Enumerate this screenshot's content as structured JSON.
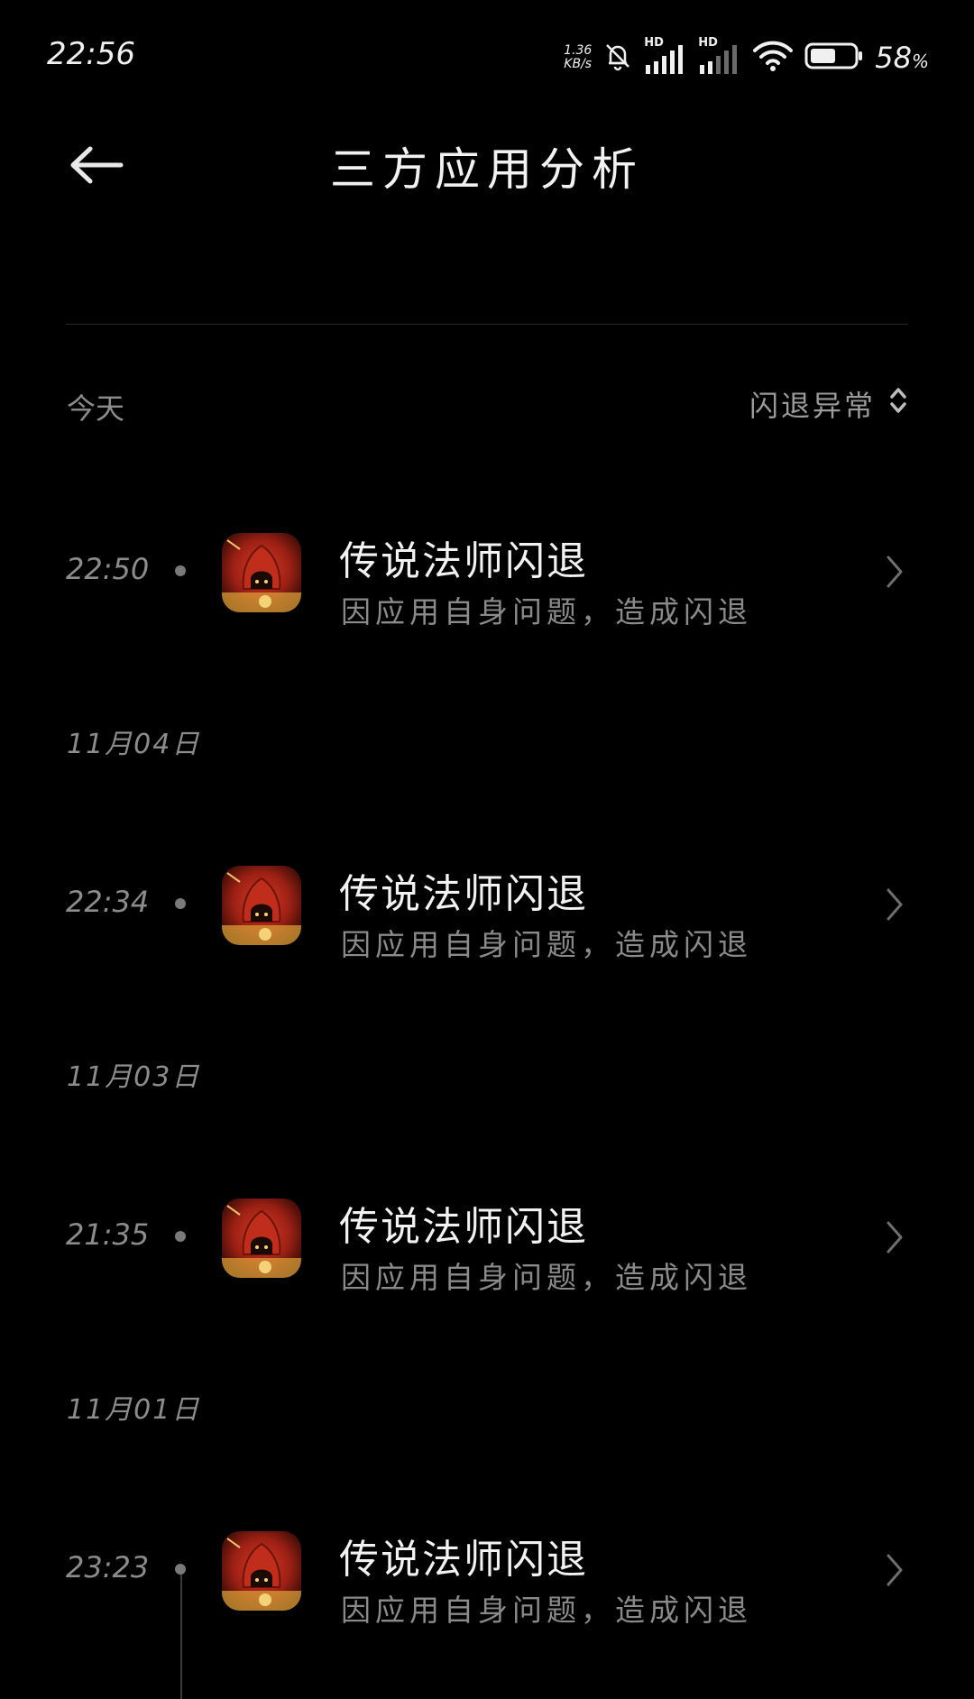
{
  "status_bar": {
    "time": "22:56",
    "net_speed_value": "1.36",
    "net_speed_unit": "KB/s",
    "signal_1_label": "HD",
    "signal_2_label": "HD",
    "battery_percent": "58",
    "battery_percent_sign": "%",
    "battery_level": 0.58
  },
  "header": {
    "title": "三方应用分析"
  },
  "section": {
    "label": "今天",
    "filter_label": "闪退异常"
  },
  "groups": [
    {
      "date": "",
      "entries": [
        {
          "time": "22:50",
          "title": "传说法师闪退",
          "subtitle": "因应用自身问题，造成闪退"
        }
      ]
    },
    {
      "date": "11月04日",
      "entries": [
        {
          "time": "22:34",
          "title": "传说法师闪退",
          "subtitle": "因应用自身问题，造成闪退"
        }
      ]
    },
    {
      "date": "11月03日",
      "entries": [
        {
          "time": "21:35",
          "title": "传说法师闪退",
          "subtitle": "因应用自身问题，造成闪退"
        }
      ]
    },
    {
      "date": "11月01日",
      "entries": [
        {
          "time": "23:23",
          "title": "传说法师闪退",
          "subtitle": "因应用自身问题，造成闪退"
        }
      ]
    }
  ],
  "colors": {
    "background": "#000000",
    "text_primary": "#f2f2f2",
    "text_secondary": "#8c8c8c",
    "icon_red": "#b8281a"
  },
  "icons": {
    "back": "arrow-left-icon",
    "filter": "sort-updown-icon",
    "row_chevron": "chevron-right-icon",
    "app": "app-icon-legendary-mage"
  }
}
